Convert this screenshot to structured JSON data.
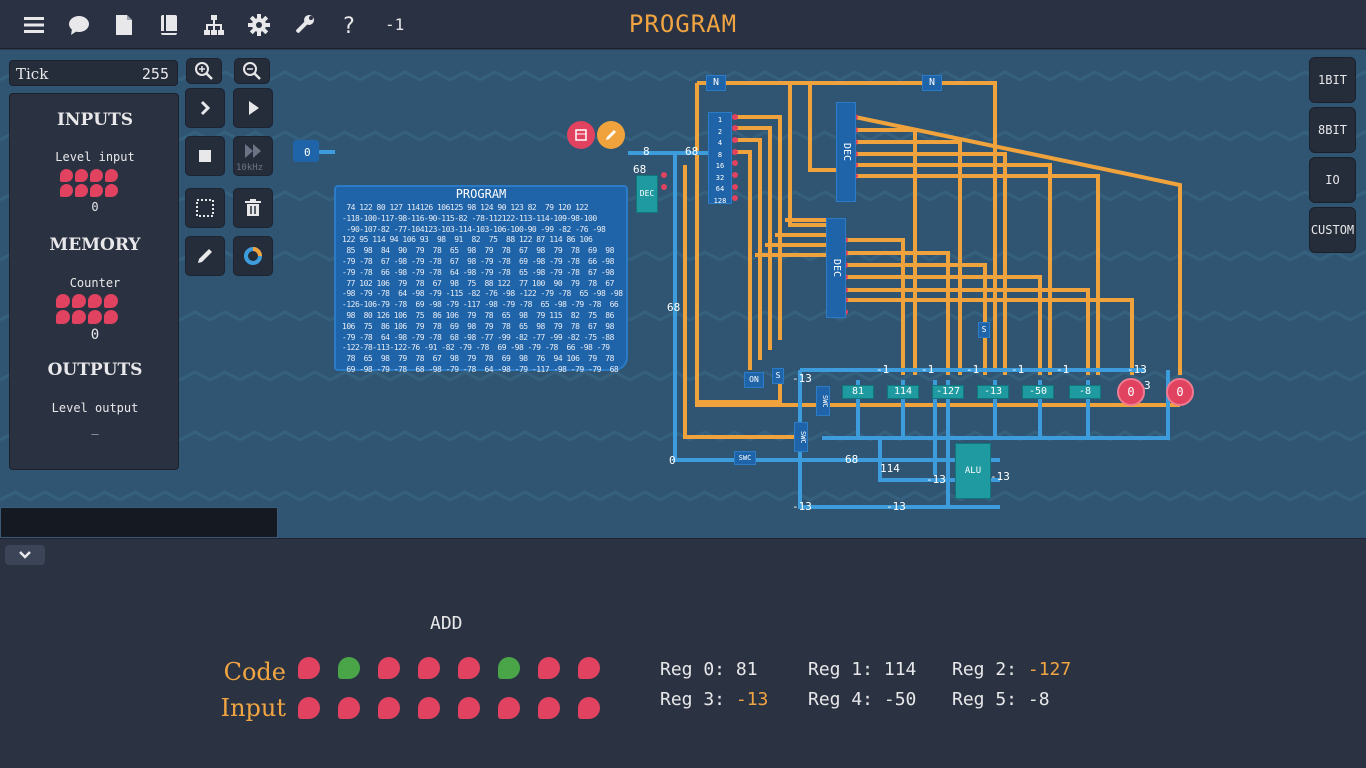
{
  "topbar": {
    "icons": [
      "menu-icon",
      "chat-icon",
      "file-icon",
      "book-icon",
      "hierarchy-icon",
      "gear-icon",
      "wrench-icon",
      "help-icon"
    ],
    "counter": "-1",
    "title": "PROGRAM"
  },
  "left": {
    "tick_label": "Tick",
    "tick_value": "255",
    "inputs_title": "INPUTS",
    "input_name": "Level input",
    "input_value": "0",
    "memory_title": "MEMORY",
    "memory_name": "Counter",
    "memory_value": "0",
    "outputs_title": "OUTPUTS",
    "output_name": "Level output",
    "output_value": "_"
  },
  "tools": {
    "speed_label": "10kHz"
  },
  "right_buttons": [
    "1BIT",
    "8BIT",
    "IO",
    "CUSTOM"
  ],
  "program": {
    "title": "PROGRAM",
    "rows": [
      " 74 122 80 127 114126 106125 98 124 90 123 82  79 120 122",
      "-118-100-117-98-116-90-115-82 -78-112122-113-114-109-98-100",
      " -90-107-82 -77-104123-103-114-103-106-100-90 -99 -82 -76 -98",
      "122 95 114 94 106 93  98  91  82  75  88 122 87 114 86 106",
      " 85  98  84  90  79  78  65  98  79  78  67  98  79  78  69  98",
      "-79 -78  67 -98 -79 -78  67  98 -79 -78  69 -98 -79 -78  66 -98",
      "-79 -78  66 -98 -79 -78  64 -98 -79 -78  65 -98 -79 -78  67 -98",
      " 77 102 106  79  78  67  98  75  88 122  77 100  90  79  78  67",
      "-98 -79 -78  64 -98 -79 -115 -82 -76 -98 -122 -79 -78  65 -98 -98",
      "-126-106-79 -78  69 -98 -79 -117 -98 -79 -78  65 -98 -79 -78  66",
      " 98  80 126 106  75  86 106  79  78  65  98  79 115  82  75  86",
      "106  75  86 106  79  78  69  98  79  78  65  98  79  78  67  98",
      "-79 -78  64 -98 -79 -78  68 -98 -77 -99 -82 -77 -99 -82 -75 -88",
      "-122-78-113-122-76 -91 -82 -79 -78  69 -98 -79 -78  66 -98 -79",
      " 78  65  98  79  78  67  98  79  78  69  98  76  94 106  79  78",
      " 69 -98 -79 -78  68 -98 -79 -78  64 -98 -79 -117 -98 -79 -79  68"
    ]
  },
  "registers_canvas": [
    "81",
    "114",
    "-127",
    "-13",
    "-50",
    "-8"
  ],
  "canvas_labels": {
    "dec": "DEC",
    "alu": "ALU",
    "swc": "SWC",
    "on": "ON",
    "n": "N",
    "s": "S",
    "v68": "68",
    "v0": "0",
    "vm13": "-13",
    "vm1": "-1",
    "v3": "3",
    "v13": "-13",
    "v114": "114",
    "v8": "8",
    "bits": [
      "1",
      "2",
      "4",
      "8",
      "16",
      "32",
      "64",
      "128"
    ]
  },
  "bottom": {
    "instruction": "ADD",
    "code_label": "Code",
    "input_label": "Input",
    "code_bits": [
      0,
      1,
      0,
      0,
      0,
      1,
      0,
      0
    ],
    "input_bits": [
      0,
      0,
      0,
      0,
      0,
      0,
      0,
      0
    ],
    "registers": [
      {
        "label": "Reg 0:",
        "value": "81",
        "neg": false
      },
      {
        "label": "Reg 1:",
        "value": "114",
        "neg": false
      },
      {
        "label": "Reg 2:",
        "value": "-127",
        "neg": true
      },
      {
        "label": "Reg 3:",
        "value": "-13",
        "neg": true
      },
      {
        "label": "Reg 4:",
        "value": "-50",
        "neg": false
      },
      {
        "label": "Reg 5:",
        "value": "-8",
        "neg": false
      }
    ]
  },
  "colors": {
    "accent": "#f1a542",
    "wire_orange": "#f0a33c",
    "wire_blue": "#3d9ddc",
    "component_teal": "#1f9aa0",
    "bit_off": "#e0425f",
    "bit_on": "#4aa549"
  }
}
